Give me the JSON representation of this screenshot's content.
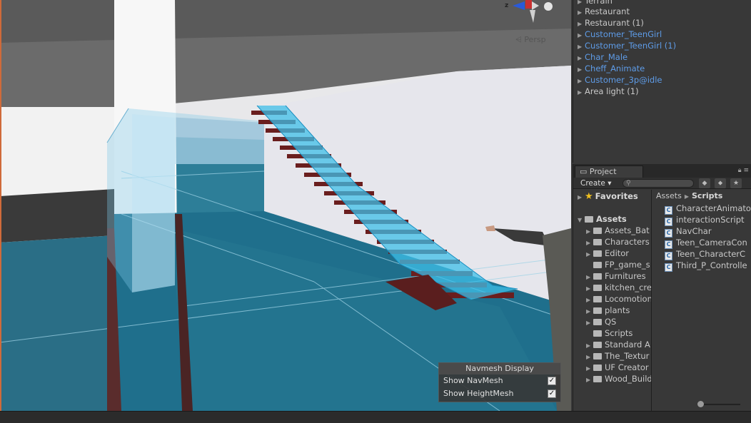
{
  "scene": {
    "projection_label": "Persp",
    "axis_label": "z",
    "navmesh_display": {
      "title": "Navmesh Display",
      "show_navmesh_label": "Show NavMesh",
      "show_navmesh_checked": true,
      "show_heightmesh_label": "Show HeightMesh",
      "show_heightmesh_checked": true
    }
  },
  "hierarchy": {
    "items": [
      {
        "label": "Terrain",
        "prefab": false
      },
      {
        "label": "Restaurant",
        "prefab": false
      },
      {
        "label": "Restaurant (1)",
        "prefab": false
      },
      {
        "label": "Customer_TeenGirl",
        "prefab": true
      },
      {
        "label": "Customer_TeenGirl (1)",
        "prefab": true
      },
      {
        "label": "Char_Male",
        "prefab": true
      },
      {
        "label": "Cheff_Animate",
        "prefab": true
      },
      {
        "label": "Customer_3p@idle",
        "prefab": true
      },
      {
        "label": "Area light (1)",
        "prefab": false
      }
    ]
  },
  "project": {
    "tab_label": "Project",
    "create_label": "Create",
    "favorites_label": "Favorites",
    "assets_label": "Assets",
    "folders": [
      "Assets_Bat",
      "Characters",
      "Editor",
      "FP_game_s",
      "Furnitures",
      "kitchen_cre",
      "Locomotion",
      "plants",
      "QS",
      "Scripts",
      "Standard A",
      "The_Textur",
      "UF Creator",
      "Wood_Build"
    ],
    "breadcrumb": [
      "Assets",
      "Scripts"
    ],
    "files": [
      "CharacterAnimato",
      "interactionScript",
      "NavChar",
      "Teen_CameraCon",
      "Teen_CharacterC",
      "Third_P_Controlle"
    ]
  },
  "colors": {
    "prefab_text": "#5e9ce8",
    "navmesh": "#2fa8d8",
    "floor": "#1f6f8c"
  }
}
